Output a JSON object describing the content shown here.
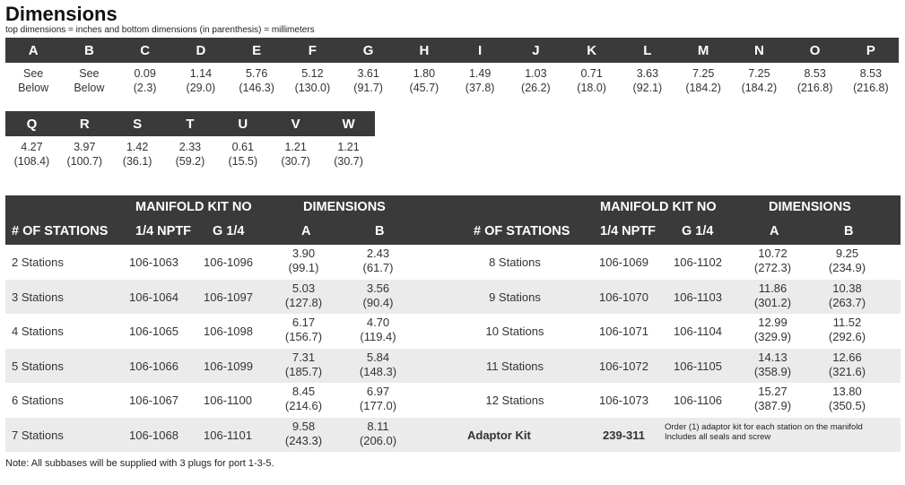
{
  "title": "Dimensions",
  "subtitle": "top dimensions = inches and bottom dimensions (in parenthesis) = millimeters",
  "dims_row1": [
    {
      "label": "A",
      "top": "See",
      "bottom": "Below"
    },
    {
      "label": "B",
      "top": "See",
      "bottom": "Below"
    },
    {
      "label": "C",
      "top": "0.09",
      "bottom": "(2.3)"
    },
    {
      "label": "D",
      "top": "1.14",
      "bottom": "(29.0)"
    },
    {
      "label": "E",
      "top": "5.76",
      "bottom": "(146.3)"
    },
    {
      "label": "F",
      "top": "5.12",
      "bottom": "(130.0)"
    },
    {
      "label": "G",
      "top": "3.61",
      "bottom": "(91.7)"
    },
    {
      "label": "H",
      "top": "1.80",
      "bottom": "(45.7)"
    },
    {
      "label": "I",
      "top": "1.49",
      "bottom": "(37.8)"
    },
    {
      "label": "J",
      "top": "1.03",
      "bottom": "(26.2)"
    },
    {
      "label": "K",
      "top": "0.71",
      "bottom": "(18.0)"
    },
    {
      "label": "L",
      "top": "3.63",
      "bottom": "(92.1)"
    },
    {
      "label": "M",
      "top": "7.25",
      "bottom": "(184.2)"
    },
    {
      "label": "N",
      "top": "7.25",
      "bottom": "(184.2)"
    },
    {
      "label": "O",
      "top": "8.53",
      "bottom": "(216.8)"
    },
    {
      "label": "P",
      "top": "8.53",
      "bottom": "(216.8)"
    }
  ],
  "dims_row2": [
    {
      "label": "Q",
      "top": "4.27",
      "bottom": "(108.4)"
    },
    {
      "label": "R",
      "top": "3.97",
      "bottom": "(100.7)"
    },
    {
      "label": "S",
      "top": "1.42",
      "bottom": "(36.1)"
    },
    {
      "label": "T",
      "top": "2.33",
      "bottom": "(59.2)"
    },
    {
      "label": "U",
      "top": "0.61",
      "bottom": "(15.5)"
    },
    {
      "label": "V",
      "top": "1.21",
      "bottom": "(30.7)"
    },
    {
      "label": "W",
      "top": "1.21",
      "bottom": "(30.7)"
    }
  ],
  "manifold": {
    "header": {
      "stations": "# OF STATIONS",
      "kit_no": "MANIFOLD KIT NO",
      "nptf": "1/4 NPTF",
      "g": "G 1/4",
      "dimensions": "DIMENSIONS",
      "a": "A",
      "b": "B"
    },
    "rows": [
      {
        "left": {
          "stations": "2 Stations",
          "nptf": "106-1063",
          "g": "106-1096",
          "a_in": "3.90",
          "a_mm": "(99.1)",
          "b_in": "2.43",
          "b_mm": "(61.7)"
        },
        "right": {
          "stations": "8 Stations",
          "nptf": "106-1069",
          "g": "106-1102",
          "a_in": "10.72",
          "a_mm": "(272.3)",
          "b_in": "9.25",
          "b_mm": "(234.9)"
        }
      },
      {
        "left": {
          "stations": "3 Stations",
          "nptf": "106-1064",
          "g": "106-1097",
          "a_in": "5.03",
          "a_mm": "(127.8)",
          "b_in": "3.56",
          "b_mm": "(90.4)"
        },
        "right": {
          "stations": "9 Stations",
          "nptf": "106-1070",
          "g": "106-1103",
          "a_in": "11.86",
          "a_mm": "(301.2)",
          "b_in": "10.38",
          "b_mm": "(263.7)"
        }
      },
      {
        "left": {
          "stations": "4 Stations",
          "nptf": "106-1065",
          "g": "106-1098",
          "a_in": "6.17",
          "a_mm": "(156.7)",
          "b_in": "4.70",
          "b_mm": "(119.4)"
        },
        "right": {
          "stations": "10 Stations",
          "nptf": "106-1071",
          "g": "106-1104",
          "a_in": "12.99",
          "a_mm": "(329.9)",
          "b_in": "11.52",
          "b_mm": "(292.6)"
        }
      },
      {
        "left": {
          "stations": "5 Stations",
          "nptf": "106-1066",
          "g": "106-1099",
          "a_in": "7.31",
          "a_mm": "(185.7)",
          "b_in": "5.84",
          "b_mm": "(148.3)"
        },
        "right": {
          "stations": "11 Stations",
          "nptf": "106-1072",
          "g": "106-1105",
          "a_in": "14.13",
          "a_mm": "(358.9)",
          "b_in": "12.66",
          "b_mm": "(321.6)"
        }
      },
      {
        "left": {
          "stations": "6 Stations",
          "nptf": "106-1067",
          "g": "106-1100",
          "a_in": "8.45",
          "a_mm": "(214.6)",
          "b_in": "6.97",
          "b_mm": "(177.0)"
        },
        "right": {
          "stations": "12 Stations",
          "nptf": "106-1073",
          "g": "106-1106",
          "a_in": "15.27",
          "a_mm": "(387.9)",
          "b_in": "13.80",
          "b_mm": "(350.5)"
        }
      }
    ],
    "last_row": {
      "left": {
        "stations": "7 Stations",
        "nptf": "106-1068",
        "g": "106-1101",
        "a_in": "9.58",
        "a_mm": "(243.3)",
        "b_in": "8.11",
        "b_mm": "(206.0)"
      },
      "adaptor_label": "Adaptor Kit",
      "adaptor_part": "239-311",
      "adaptor_note_1": "Order (1) adaptor kit for each station on the manifold",
      "adaptor_note_2": "Includes all seals and screw"
    }
  },
  "note": "Note: All subbases will be supplied with 3 plugs for port 1-3-5."
}
